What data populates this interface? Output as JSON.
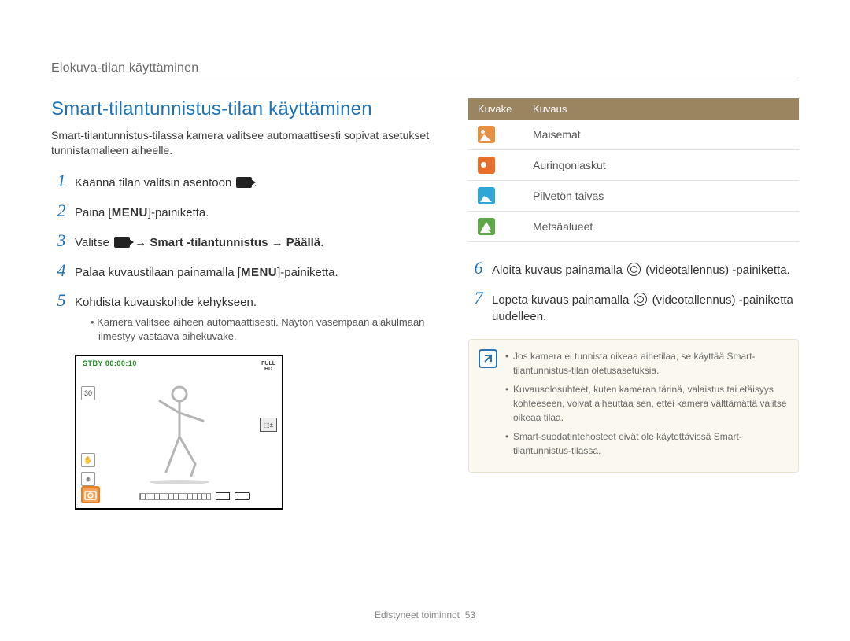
{
  "breadcrumb": "Elokuva-tilan käyttäminen",
  "section_title": "Smart-tilantunnistus-tilan käyttäminen",
  "intro": "Smart-tilantunnistus-tilassa kamera valitsee automaattisesti sopivat asetukset tunnistamalleen aiheelle.",
  "steps_left": {
    "s1": {
      "num": "1",
      "text_pre": "Käännä tilan valitsin asentoon ",
      "text_post": "."
    },
    "s2": {
      "num": "2",
      "text_pre": "Paina [",
      "menu": "MENU",
      "text_post": "]-painiketta."
    },
    "s3": {
      "num": "3",
      "text_pre": "Valitse ",
      "bold": " → Smart -tilantunnistus → Päällä",
      "text_post": "."
    },
    "s4": {
      "num": "4",
      "text_pre": "Palaa kuvaustilaan painamalla [",
      "menu": "MENU",
      "text_post": "]-painiketta."
    },
    "s5": {
      "num": "5",
      "text": "Kohdista kuvauskohde kehykseen.",
      "sub": "Kamera valitsee aiheen automaattisesti. Näytön vasempaan alakulmaan ilmestyy vastaava aihekuvake."
    }
  },
  "preview": {
    "top_status": "STBY 00:00:10",
    "topright_line1": "FULL",
    "topright_line2": "HD"
  },
  "icon_table": {
    "header_icon": "Kuvake",
    "header_desc": "Kuvaus",
    "rows": [
      {
        "desc": "Maisemat",
        "cls": "ic-landscape"
      },
      {
        "desc": "Auringonlaskut",
        "cls": "ic-sunset"
      },
      {
        "desc": "Pilvetön taivas",
        "cls": "ic-sky"
      },
      {
        "desc": "Metsäalueet",
        "cls": "ic-forest"
      }
    ]
  },
  "steps_right": {
    "s6": {
      "num": "6",
      "pre": "Aloita kuvaus painamalla ",
      "post": " (videotallennus) -painiketta."
    },
    "s7": {
      "num": "7",
      "pre": "Lopeta kuvaus painamalla ",
      "post": " (videotallennus) -painiketta uudelleen."
    }
  },
  "notes": [
    "Jos kamera ei tunnista oikeaa aihetilaa, se käyttää Smart-tilantunnistus-tilan oletusasetuksia.",
    "Kuvausolosuhteet, kuten kameran tärinä, valaistus tai etäisyys kohteeseen, voivat aiheuttaa sen, ettei kamera välttämättä valitse oikeaa tilaa.",
    "Smart-suodatintehosteet eivät ole käytettävissä Smart-tilantunnistus-tilassa."
  ],
  "footer": {
    "section": "Edistyneet toiminnot",
    "page": "53"
  }
}
